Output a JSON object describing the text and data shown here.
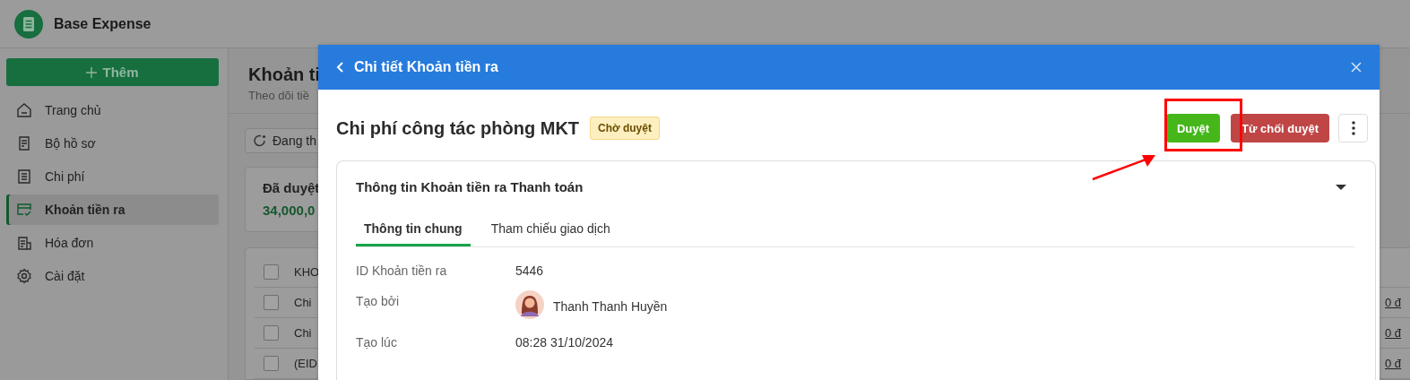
{
  "app": {
    "name": "Base Expense"
  },
  "sidebar": {
    "add_button": "Thêm",
    "items": [
      {
        "label": "Trang chủ",
        "selected": false
      },
      {
        "label": "Bộ hồ sơ",
        "selected": false
      },
      {
        "label": "Chi phí",
        "selected": false
      },
      {
        "label": "Khoản tiền ra",
        "selected": true
      },
      {
        "label": "Hóa đơn",
        "selected": false
      },
      {
        "label": "Cài đặt",
        "selected": false
      }
    ]
  },
  "page": {
    "title": "Khoản ti",
    "subtitle": "Theo dõi tiề",
    "refresh_button": "Đang th",
    "summary": {
      "label": "Đã duyệt",
      "amount": "34,000,0"
    },
    "table": {
      "header": {
        "label": "KHO",
        "checked": false
      },
      "rows": [
        {
          "name": "Chi",
          "amount": "0 đ",
          "checked": false
        },
        {
          "name": "Chi",
          "amount": "0 đ",
          "checked": false
        },
        {
          "name": "(EID",
          "amount": "0 đ",
          "checked": false
        }
      ]
    }
  },
  "modal": {
    "title": "Chi tiết Khoản tiền ra",
    "heading": "Chi phí công tác phòng MKT",
    "status": "Chờ duyệt",
    "actions": [
      {
        "label": "Duyệt",
        "kind": "approve"
      },
      {
        "label": "Từ chối duyệt",
        "kind": "reject"
      }
    ],
    "section": {
      "title": "Thông tin Khoản tiền ra Thanh toán",
      "expanded": true,
      "tabs": [
        {
          "label": "Thông tin chung",
          "selected": true
        },
        {
          "label": "Tham chiếu giao dịch",
          "selected": false
        }
      ],
      "fields": [
        {
          "label": "ID Khoản tiền ra",
          "value": "5446",
          "kind": "text"
        },
        {
          "label": "Tạo bởi",
          "value": "Thanh Thanh Huyền",
          "kind": "user"
        },
        {
          "label": "Tạo lúc",
          "value": "08:28 31/10/2024",
          "kind": "text"
        }
      ]
    }
  }
}
